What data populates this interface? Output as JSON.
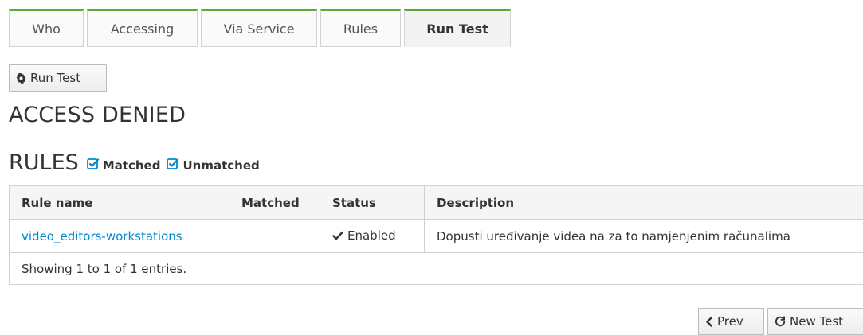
{
  "tabs": [
    {
      "label": "Who",
      "active": false
    },
    {
      "label": "Accessing",
      "active": false
    },
    {
      "label": "Via Service",
      "active": false
    },
    {
      "label": "Rules",
      "active": false
    },
    {
      "label": "Run Test",
      "active": true
    }
  ],
  "run_test_button": {
    "label": "Run Test",
    "icon": "gear-icon"
  },
  "result": {
    "heading": "ACCESS DENIED"
  },
  "rules_section": {
    "heading": "RULES",
    "filters": [
      {
        "label": "Matched",
        "checked": true
      },
      {
        "label": "Unmatched",
        "checked": true
      }
    ]
  },
  "table": {
    "headers": {
      "rule_name": "Rule name",
      "matched": "Matched",
      "status": "Status",
      "description": "Description"
    },
    "rows": [
      {
        "rule_name": "video_editors-workstations",
        "matched": "",
        "status": "Enabled",
        "description": "Dopusti uređivanje videa na za to namjenjenim računalima"
      }
    ],
    "footer": "Showing 1 to 1 of 1 entries."
  },
  "pager": {
    "prev_label": "Prev",
    "new_test_label": "New Test"
  },
  "colors": {
    "tab_accent": "#5aab34",
    "link": "#0088ce",
    "checkbox": "#0088ce"
  }
}
